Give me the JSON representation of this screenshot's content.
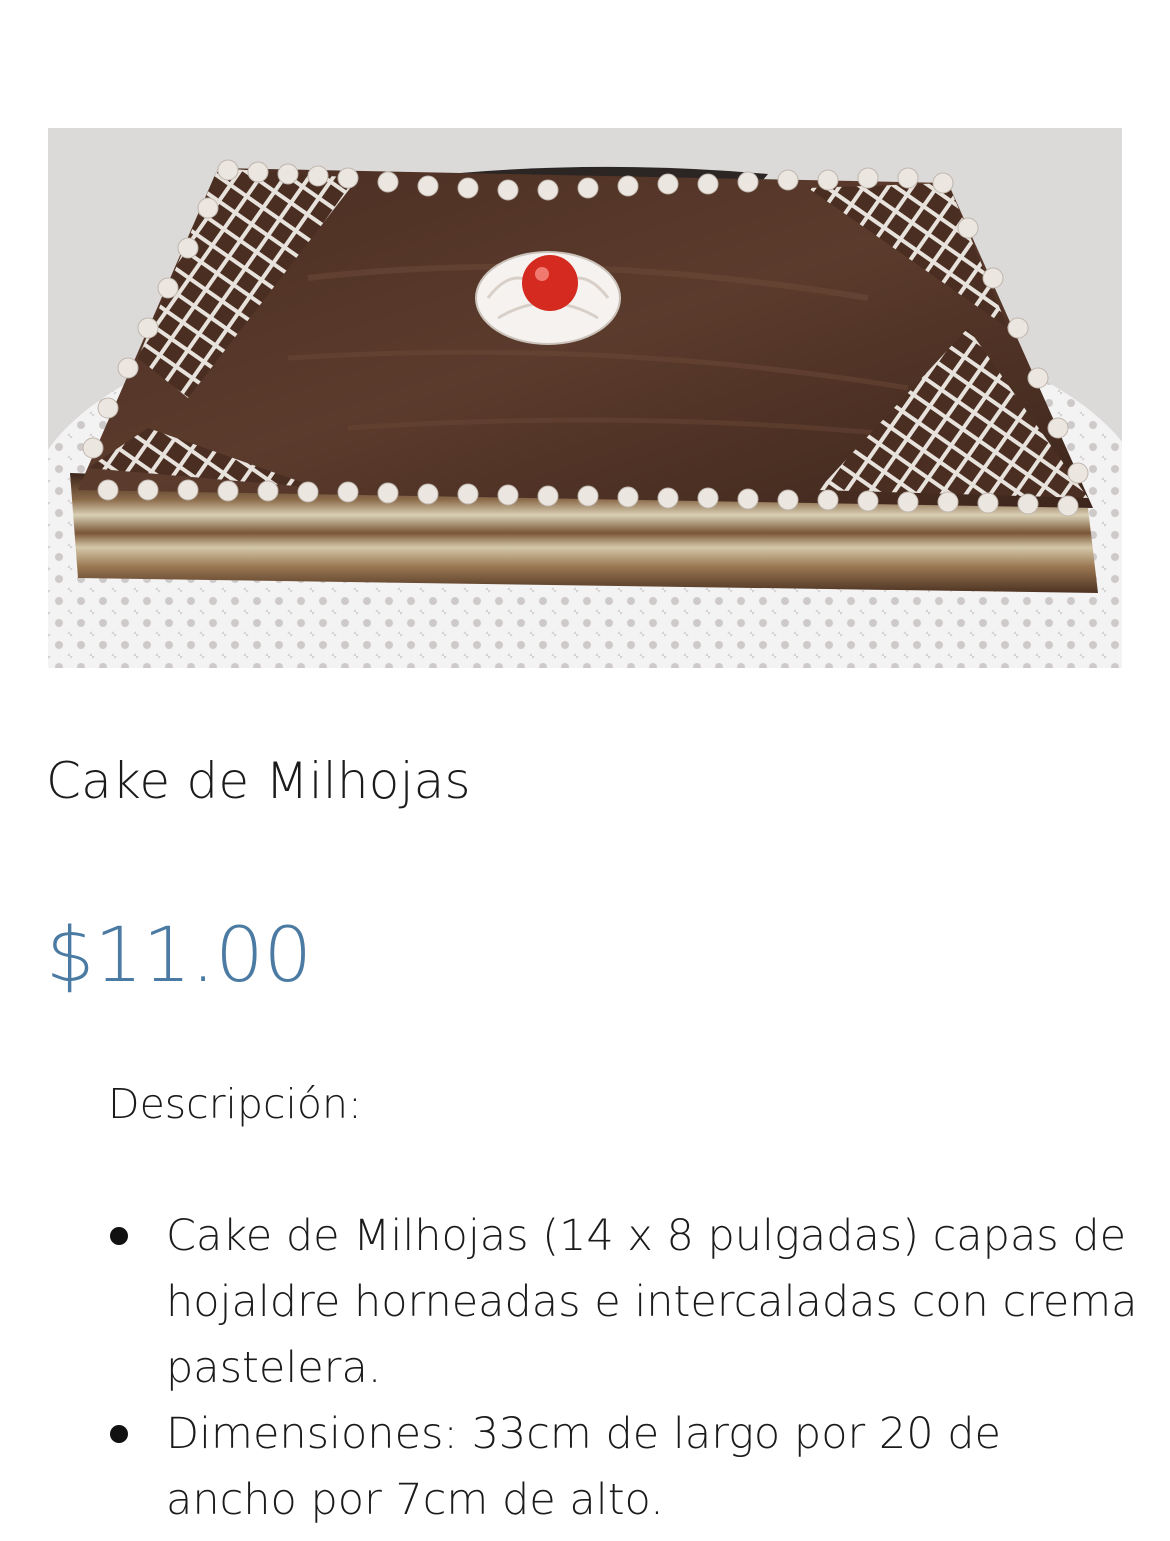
{
  "product": {
    "image_alt": "cake-photo",
    "title": "Cake de Milhojas",
    "price": "$11.00",
    "description_heading": "Descripción:",
    "description_items": [
      "Cake de Milhojas (14 x 8 pulgadas) capas de hojaldre horneadas e intercaladas con crema pastelera.",
      "Dimensiones: 33cm de largo por 20 de ancho por 7cm de alto."
    ]
  },
  "colors": {
    "price": "#4b7ba3",
    "text": "#1b1b1b",
    "background": "#ffffff"
  }
}
